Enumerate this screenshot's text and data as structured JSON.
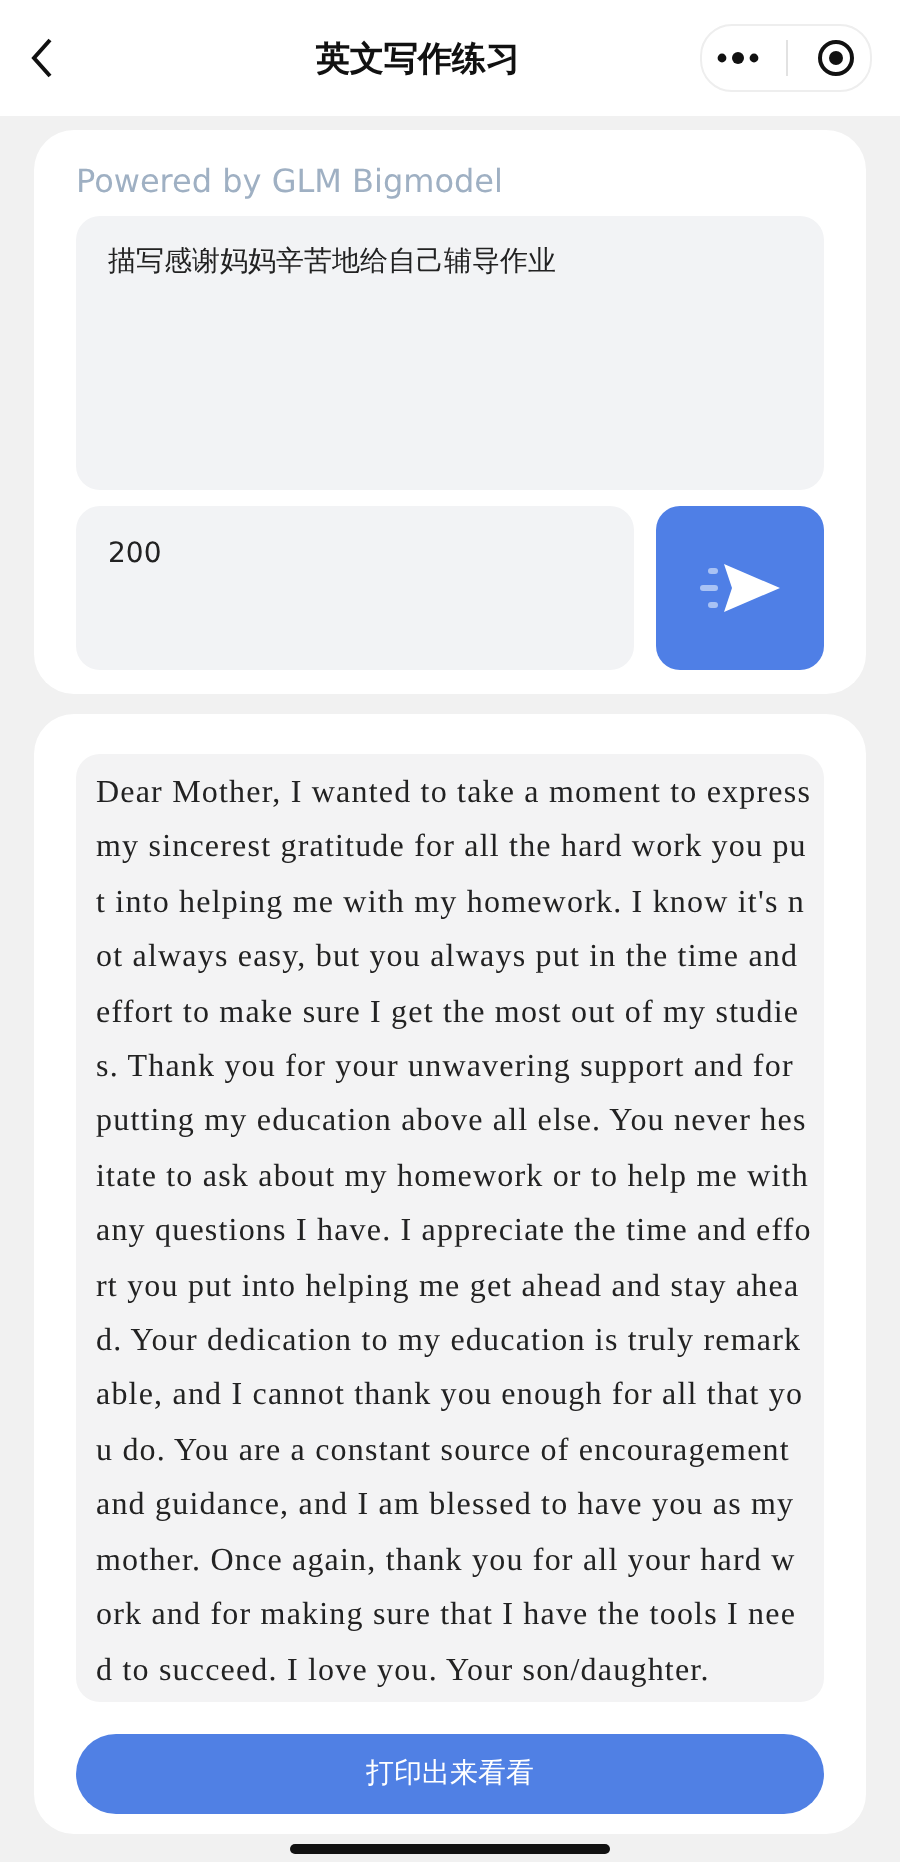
{
  "nav": {
    "title": "英文写作练习"
  },
  "prompt_card": {
    "powered_by": "Powered by GLM Bigmodel",
    "topic": "描写感谢妈妈辛苦地给自己辅导作业",
    "word_count": "200"
  },
  "result_card": {
    "essay": "Dear Mother, I wanted to take a moment to express my sincerest gratitude for all the hard work you put into helping me with my homework. I know it's not always easy, but you always put in the time and effort to make sure I get the most out of my studies. Thank you for your unwavering support and for putting my education above all else. You never hesitate to ask about my homework or to help me with any questions I have. I appreciate the time and effort you put into helping me get ahead and stay ahead. Your dedication to my education is truly remarkable, and I cannot thank you enough for all that you do. You are a constant source of encouragement and guidance, and I am blessed to have you as my mother. Once again, thank you for all your hard work and for making sure that I have the tools I need to succeed. I love you. Your son/daughter.",
    "print_button": "打印出来看看"
  }
}
